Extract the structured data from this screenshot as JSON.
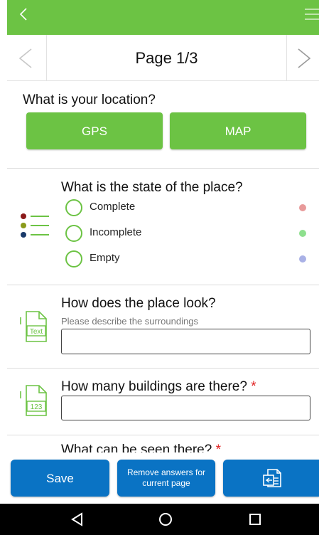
{
  "header": {
    "back_icon": "chevron-left-icon",
    "menu_icon": "hamburger-menu-icon",
    "color": "#6cc344"
  },
  "pager": {
    "title": "Page 1/3",
    "prev_icon": "chevron-left-icon",
    "next_icon": "chevron-right-icon"
  },
  "location": {
    "question": "What is your location?",
    "gps_label": "GPS",
    "map_label": "MAP"
  },
  "state_question": {
    "title": "What is the state of the place?",
    "icon": "list-icon",
    "options": [
      {
        "label": "Complete",
        "color": "#e89a9a"
      },
      {
        "label": "Incomplete",
        "color": "#8ee08e"
      },
      {
        "label": "Empty",
        "color": "#a9b1e6"
      }
    ]
  },
  "look_question": {
    "title": "How does the place look?",
    "hint": "Please describe the surroundings",
    "icon_label": "Text",
    "value": ""
  },
  "buildings_question": {
    "title": "How many buildings are there?",
    "required_mark": "*",
    "icon_label": "123",
    "value": ""
  },
  "next_question": {
    "title": "What can be seen there?",
    "required_mark": "*"
  },
  "actions": {
    "save_label": "Save",
    "remove_label_line1": "Remove answers for",
    "remove_label_line2": "current page",
    "share_icon": "share-document-icon",
    "color": "#0a73c4"
  },
  "system_nav": {
    "back_icon": "nav-back-icon",
    "home_icon": "nav-home-icon",
    "recents_icon": "nav-recents-icon"
  }
}
